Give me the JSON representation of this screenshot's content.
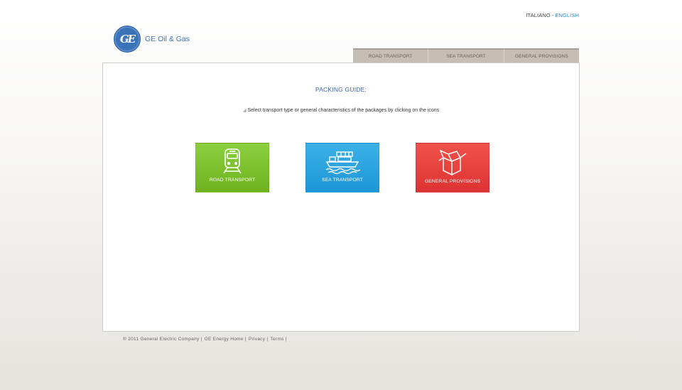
{
  "language": {
    "italian": "ITALIANO",
    "separator": "-",
    "english": "ENGLISH"
  },
  "logo": {
    "mark": "GE",
    "text": "GE Oil & Gas"
  },
  "tabs": [
    {
      "label": "ROAD TRANSPORT"
    },
    {
      "label": "SEA TRANSPORT"
    },
    {
      "label": "GENERAL PROVISIONS"
    }
  ],
  "main": {
    "title": "PACKING GUIDE:",
    "instruction": "Select transport type or general characteristics  of the packages  by clicking on the icons",
    "tiles": [
      {
        "label": "ROAD TRANSPORT",
        "icon": "train-icon",
        "color": "#7cc12d"
      },
      {
        "label": "SEA TRANSPORT",
        "icon": "ship-icon",
        "color": "#2aa3e0"
      },
      {
        "label": "GENERAL PROVISIONS",
        "icon": "box-icon",
        "color": "#e8403e"
      }
    ]
  },
  "footer": {
    "copyright": "® 2011 General Electric Company |",
    "energy_home": "GE Energy Home |",
    "privacy": "Privacy |",
    "terms": "Terms |"
  },
  "colors": {
    "brand_blue": "#3b73b9",
    "link_blue": "#2a8fd4",
    "tab_bg": "#c6bdb4"
  }
}
